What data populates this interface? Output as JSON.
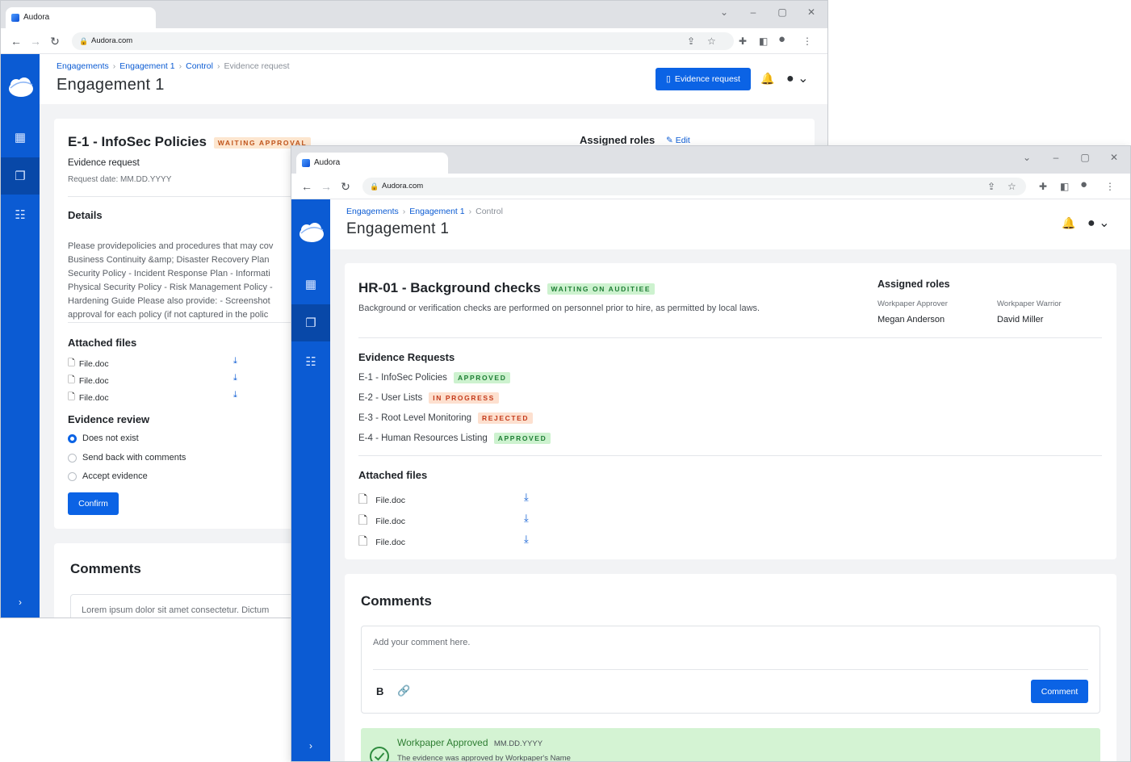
{
  "back_window": {
    "tab_title": "Audora",
    "url": "Audora.com",
    "breadcrumbs": [
      "Engagements",
      "Engagement 1",
      "Control",
      "Evidence request"
    ],
    "page_title": "Engagement 1",
    "header_button": "Evidence request",
    "card": {
      "title": "E-1 - InfoSec Policies",
      "status": "WAITING APPROVAL",
      "subtitle": "Evidence request",
      "request_date": "Request date: MM.DD.YYYY",
      "assigned_roles": "Assigned roles",
      "edit": "Edit",
      "details_heading": "Details",
      "details_lines": [
        "Please providepolicies and procedures that may cov",
        "Business Continuity &amp; Disaster Recovery Plan",
        "Security Policy - Incident Response Plan - Informati",
        "Physical Security Policy - Risk Management Policy -",
        "Hardening Guide Please also provide: - Screenshot",
        "approval for each policy (if not captured in the polic"
      ],
      "attached_heading": "Attached files",
      "files": [
        "File.doc",
        "File.doc",
        "File.doc"
      ],
      "review_heading": "Evidence review",
      "review_options": [
        "Does not exist",
        "Send back with comments",
        "Accept evidence"
      ],
      "confirm": "Confirm"
    },
    "comments": {
      "heading": "Comments",
      "preview": "Lorem ipsum dolor sit amet consectetur. Dictum"
    }
  },
  "front_window": {
    "tab_title": "Audora",
    "url": "Audora.com",
    "breadcrumbs": [
      "Engagements",
      "Engagement 1",
      "Control"
    ],
    "page_title": "Engagement 1",
    "card": {
      "title": "HR-01 - Background checks",
      "status": "WAITING ON AUDITIEE",
      "description": "Background or verification checks are performed on personnel prior to hire, as permitted by local laws.",
      "assigned_roles": "Assigned roles",
      "roles": [
        {
          "role": "Workpaper Approver",
          "name": "Megan Anderson"
        },
        {
          "role": "Workpaper Warrior",
          "name": "David Miller"
        }
      ],
      "evidence_heading": "Evidence Requests",
      "evidence_requests": [
        {
          "name": "E-1 - InfoSec Policies",
          "status": "APPROVED"
        },
        {
          "name": "E-2 - User Lists",
          "status": "IN PROGRESS"
        },
        {
          "name": "E-3 - Root Level Monitoring",
          "status": "REJECTED"
        },
        {
          "name": "E-4 - Human Resources Listing",
          "status": "APPROVED"
        }
      ],
      "attached_heading": "Attached files",
      "files": [
        "File.doc",
        "File.doc",
        "File.doc"
      ]
    },
    "comments": {
      "heading": "Comments",
      "placeholder": "Add your comment here.",
      "bold_label": "B",
      "submit": "Comment",
      "approved_title": "Workpaper Approved",
      "approved_date": "MM.DD.YYYY",
      "approved_text": "The evidence was approved by Workpaper's Name"
    }
  },
  "colors": {
    "sidebar": "#0b5bd3",
    "primary": "#0b63e5",
    "approved_bg": "#cdf2cf",
    "warning_bg": "#fde6cf"
  }
}
